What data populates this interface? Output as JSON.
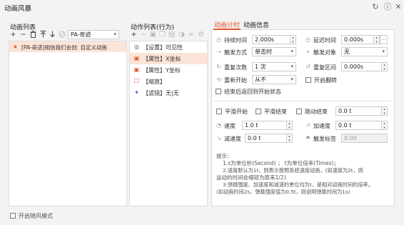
{
  "window": {
    "title": "动画风暴"
  },
  "left": {
    "heading": "动画列表",
    "preset_select": "PA-奇迹",
    "items": [
      {
        "label": "[PA-奇迹]相信我们会创: 自定义动画"
      }
    ],
    "fullscreen_mode_label": "开启随风模式"
  },
  "middle": {
    "heading": "动作列表(行为)",
    "actions": [
      {
        "label": "【设置】可见性"
      },
      {
        "label": "【属性】X坐标"
      },
      {
        "label": "【属性】Y坐标"
      },
      {
        "label": "【缩放】"
      },
      {
        "label": "【滤镜】无|无"
      }
    ]
  },
  "right": {
    "tabs": [
      {
        "label": "动画计时"
      },
      {
        "label": "动画信息"
      }
    ],
    "duration_label": "持续时间",
    "duration_value": "2.000s",
    "delay_label": "延迟时间",
    "delay_value": "0.000s",
    "trigger_label": "触发方式",
    "trigger_value": "单击时",
    "trigger_object_label": "触发对象",
    "trigger_object_value": "无",
    "repeat_label": "重复次数",
    "repeat_value": "1 次",
    "repeat_interval_label": "重复区间",
    "repeat_interval_value": "0.000s",
    "restart_label": "重新开始",
    "restart_value": "从不",
    "flip_label": "开启翻转",
    "end_return_label": "结束后返回到开始状态",
    "smooth_start_label": "平滑开始",
    "smooth_end_label": "平滑结束",
    "bounce_end_label": "跳动结束",
    "bounce_value": "0.0 t",
    "speed_label": "速度",
    "speed_value": "1.0 t",
    "accel_label": "加速度",
    "accel_value": "0.0 t",
    "decel_label": "减速度",
    "decel_value": "0.0 t",
    "trigger_tag_label": "触发标签",
    "trigger_tag_value": "0.00",
    "hints": [
      "提示：",
      "1.s为单位秒(Second) ；  t为单位倍率(Times)；",
      "2.速度默认为1t，则表示按照系统速度动画，(如速度为2t，则",
      "运动的时间会缩短为原来1/2)",
      "3.弹跳强度、加速度和减速的单位均为t，是相对动画时间的倍率。",
      "(如动画时间2s，弹跳强度值为0.5t，则说明弹跳时间为1s)"
    ]
  },
  "colors": {
    "accent": "#e0572b",
    "selected_row": "#fde4d8",
    "tab_underline": "#e0572b"
  }
}
